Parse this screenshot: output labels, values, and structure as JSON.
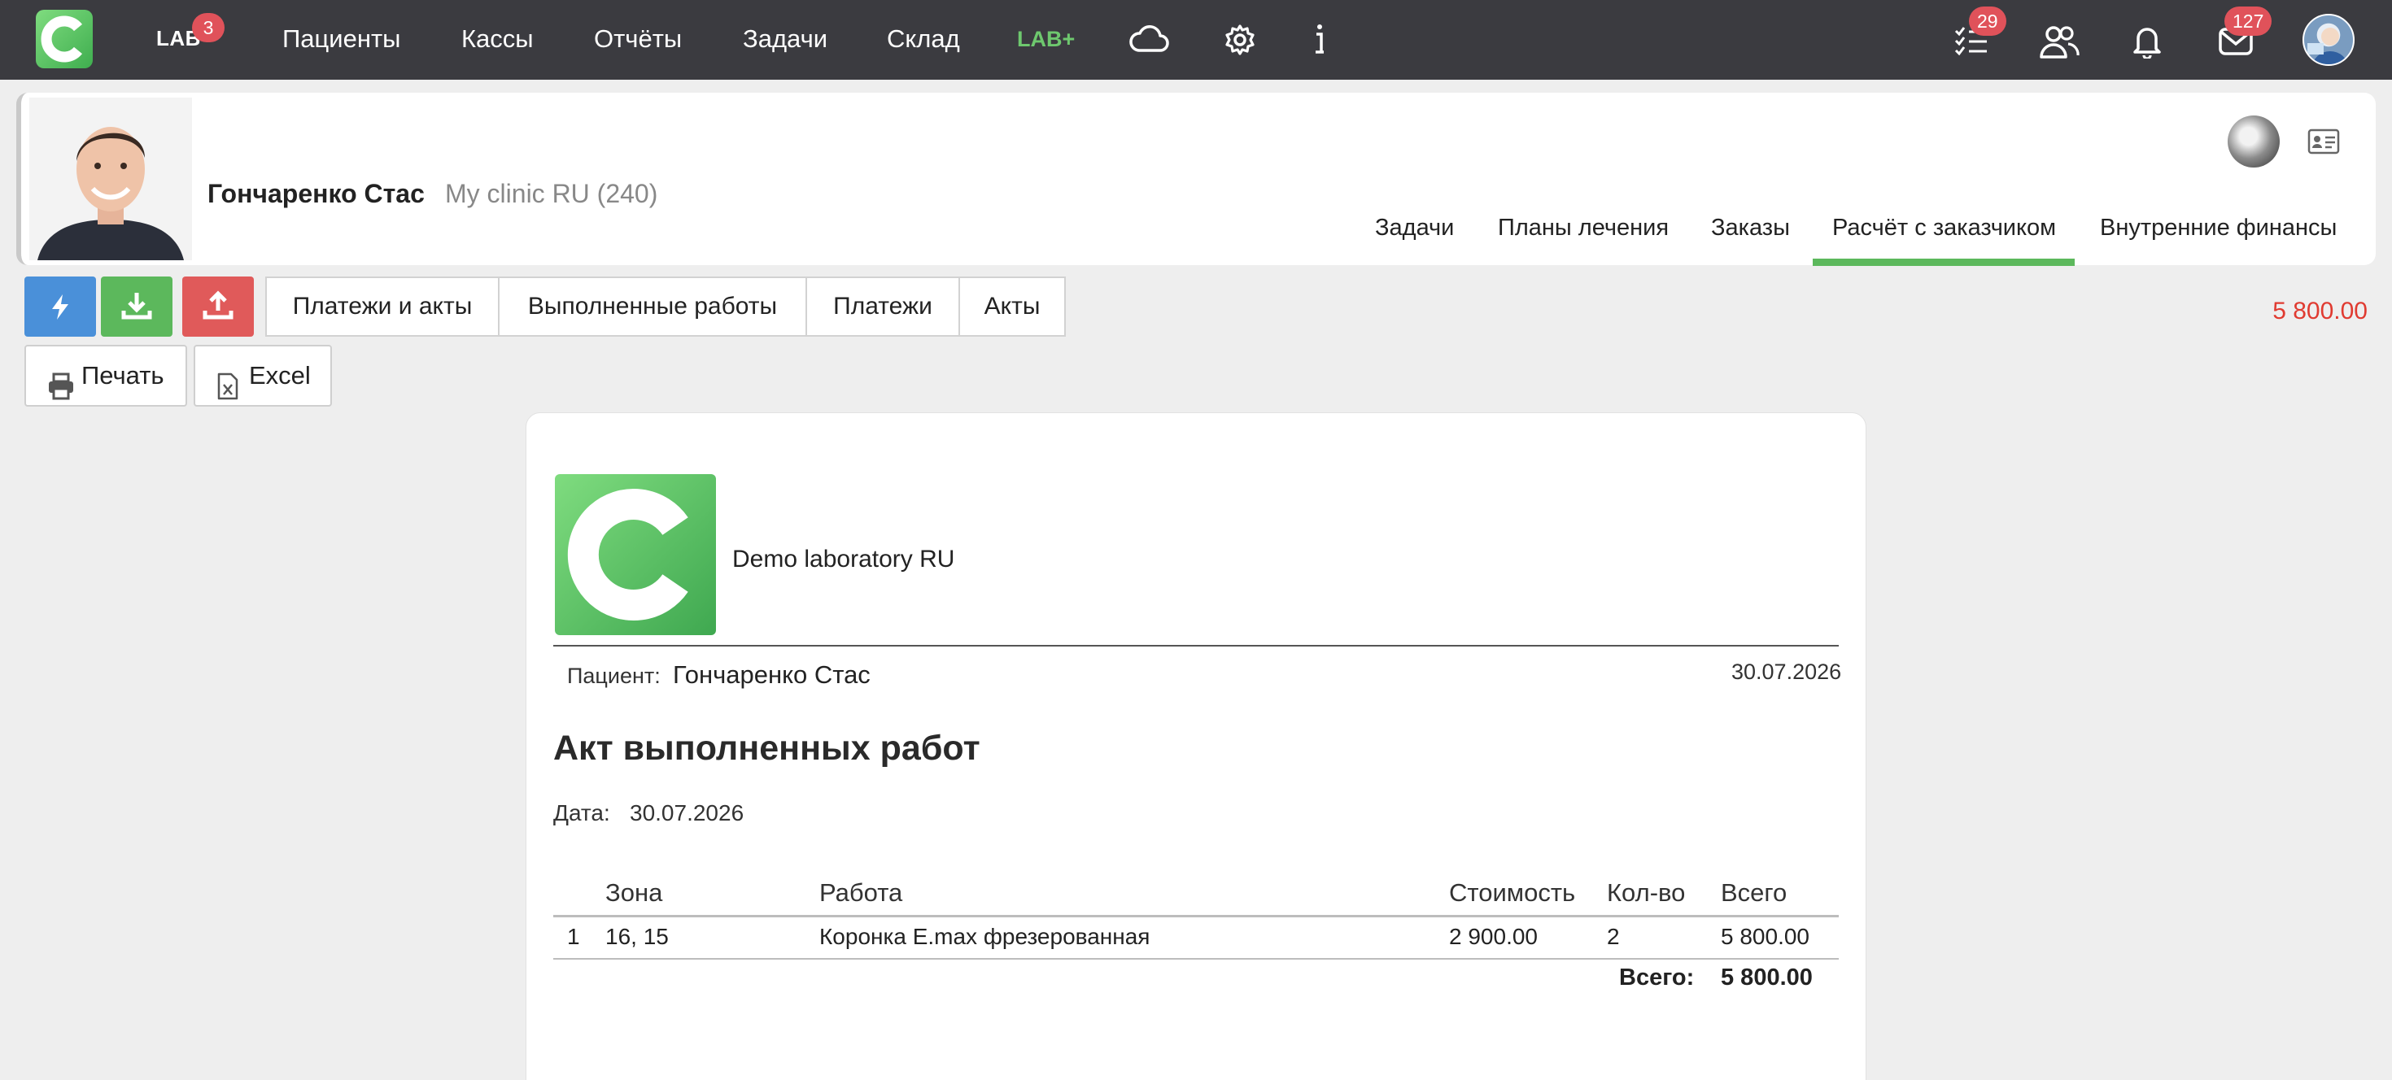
{
  "nav": {
    "lab_label": "LAB",
    "lab_badge": "3",
    "items": [
      "Пациенты",
      "Кассы",
      "Отчёты",
      "Задачи",
      "Склад"
    ],
    "labplus": "LAB+",
    "tasks_badge": "29",
    "mail_badge": "127"
  },
  "patient": {
    "name": "Гончаренко Стас",
    "clinic": "My clinic RU (240)"
  },
  "tabs": [
    "Задачи",
    "Планы лечения",
    "Заказы",
    "Расчёт с заказчиком",
    "Внутренние финансы"
  ],
  "active_tab": "Расчёт с заказчиком",
  "toolbar": {
    "segments": [
      "Платежи и акты",
      "Выполненные работы",
      "Платежи",
      "Акты"
    ],
    "balance": "5 800.00",
    "print_label": "Печать",
    "excel_label": "Excel"
  },
  "document": {
    "lab_name": "Demo laboratory RU",
    "patient_label": "Пациент:",
    "patient_name": "Гончаренко Стас",
    "header_date": "30.07.2026",
    "title": "Акт выполненных работ",
    "date_label": "Дата:",
    "date_value": "30.07.2026",
    "table": {
      "headers": [
        "Зона",
        "Работа",
        "Стоимость",
        "Кол-во",
        "Всего"
      ],
      "rows": [
        {
          "num": "1",
          "zone": "16, 15",
          "work": "Коронка E.max фрезерованная",
          "price": "2 900.00",
          "qty": "2",
          "total": "5 800.00"
        }
      ],
      "total_label": "Всего:",
      "total_value": "5 800.00"
    }
  },
  "colors": {
    "topbar": "#3b3b40",
    "accent_green": "#5cb85c",
    "badge_red": "#e0525a",
    "btn_blue": "#4a90d9",
    "btn_green": "#5cb85c",
    "btn_red": "#e05a5a",
    "balance_red": "#e03b31"
  }
}
